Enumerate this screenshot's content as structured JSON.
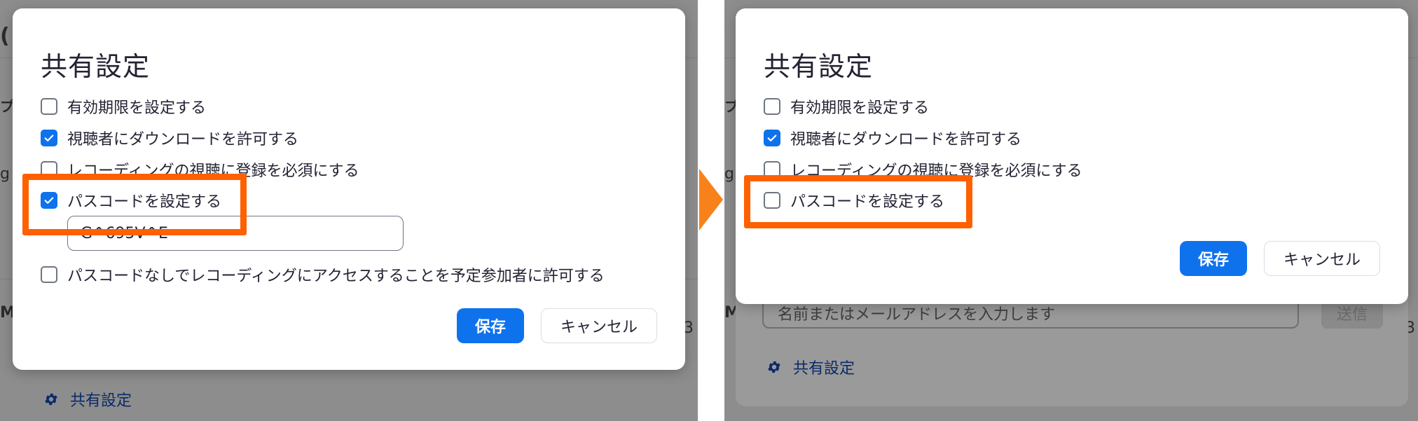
{
  "before": {
    "dialog": {
      "title": "共有設定",
      "options": [
        {
          "label": "有効期限を設定する",
          "checked": false
        },
        {
          "label": "視聴者にダウンロードを許可する",
          "checked": true
        },
        {
          "label": "レコーディングの視聴に登録を必須にする",
          "checked": false
        },
        {
          "label": "パスコードを設定する",
          "checked": true
        },
        {
          "label": "パスコードなしでレコーディングにアクセスすることを予定参加者に許可する",
          "checked": false
        }
      ],
      "passcode_value": "G^695V^E",
      "save_label": "保存",
      "cancel_label": "キャンセル"
    },
    "background": {
      "share_settings_label": "共有設定",
      "edge_letters": [
        "プ",
        "g",
        "M",
        "3"
      ]
    }
  },
  "after": {
    "dialog": {
      "title": "共有設定",
      "options": [
        {
          "label": "有効期限を設定する",
          "checked": false
        },
        {
          "label": "視聴者にダウンロードを許可する",
          "checked": true
        },
        {
          "label": "レコーディングの視聴に登録を必須にする",
          "checked": false
        },
        {
          "label": "パスコードを設定する",
          "checked": false
        }
      ],
      "save_label": "保存",
      "cancel_label": "キャンセル"
    },
    "background": {
      "email_placeholder": "名前またはメールアドレスを入力します",
      "send_label": "送信",
      "share_settings_label": "共有設定",
      "edge_letters": [
        "プ",
        "g",
        "M",
        "3"
      ]
    }
  },
  "colors": {
    "primary": "#0e72ed",
    "highlight": "#ff6000",
    "arrow": "#f7821b",
    "overlay": "#8d8d8d"
  }
}
